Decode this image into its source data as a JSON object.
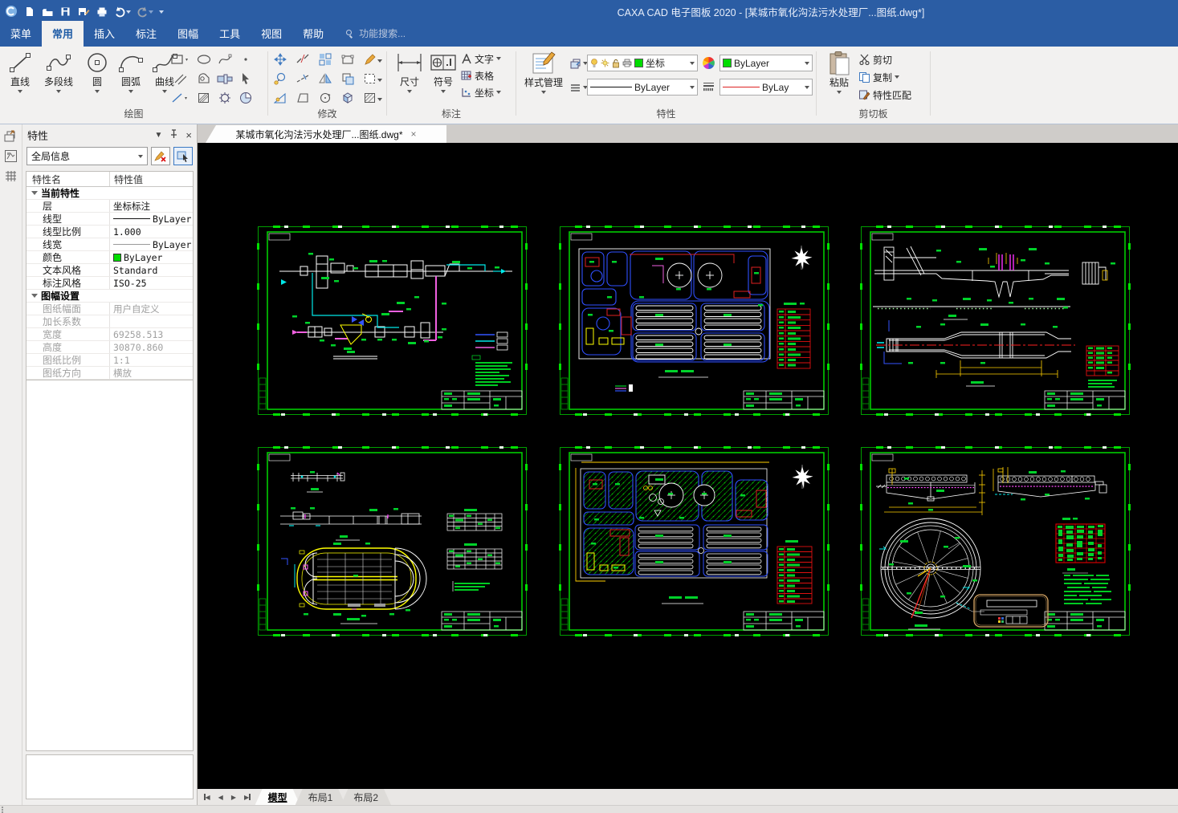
{
  "window": {
    "title": "CAXA CAD 电子图板 2020 - [某城市氧化沟法污水处理厂...图纸.dwg*]"
  },
  "menu_tabs": [
    {
      "label": "菜单",
      "active": false
    },
    {
      "label": "常用",
      "active": true
    },
    {
      "label": "插入",
      "active": false
    },
    {
      "label": "标注",
      "active": false
    },
    {
      "label": "图幅",
      "active": false
    },
    {
      "label": "工具",
      "active": false
    },
    {
      "label": "视图",
      "active": false
    },
    {
      "label": "帮助",
      "active": false
    }
  ],
  "search": {
    "label": "功能搜索..."
  },
  "ribbon": {
    "draw": {
      "label": "绘图",
      "buttons": [
        "直线",
        "多段线",
        "圆",
        "圆弧",
        "曲线"
      ]
    },
    "modify": {
      "label": "修改"
    },
    "annotate": {
      "label": "标注",
      "dimension": "尺寸",
      "symbol": "符号",
      "text": "文字",
      "table": "表格",
      "coordinate": "坐标"
    },
    "properties": {
      "label": "特性",
      "style_manage": "样式管理",
      "layer_value": "坐标",
      "color_value": "ByLayer",
      "linetype_value": "ByLayer",
      "lineweight_value": "ByLay"
    },
    "clipboard": {
      "label": "剪切板",
      "paste": "粘贴",
      "cut": "剪切",
      "copy": "复制",
      "match": "特性匹配"
    }
  },
  "properties_panel": {
    "title": "特性",
    "scope_value": "全局信息",
    "columns": {
      "name": "特性名",
      "value": "特性值"
    },
    "rows": [
      {
        "type": "group",
        "name": "当前特性"
      },
      {
        "type": "item",
        "name": "层",
        "value": "坐标标注"
      },
      {
        "type": "item",
        "name": "线型",
        "value": "ByLayer",
        "swatch": "linetype"
      },
      {
        "type": "item",
        "name": "线型比例",
        "value": "1.000"
      },
      {
        "type": "item",
        "name": "线宽",
        "value": "ByLayer",
        "swatch": "lineweight"
      },
      {
        "type": "item",
        "name": "颜色",
        "value": "ByLayer",
        "swatch": "color"
      },
      {
        "type": "item",
        "name": "文本风格",
        "value": "Standard"
      },
      {
        "type": "item",
        "name": "标注风格",
        "value": "ISO-25"
      },
      {
        "type": "group",
        "name": "图幅设置"
      },
      {
        "type": "item",
        "name": "图纸幅面",
        "value": "用户自定义",
        "disabled": true
      },
      {
        "type": "item",
        "name": "加长系数",
        "value": "",
        "disabled": true
      },
      {
        "type": "item",
        "name": "宽度",
        "value": "69258.513",
        "disabled": true
      },
      {
        "type": "item",
        "name": "高度",
        "value": "30870.860",
        "disabled": true
      },
      {
        "type": "item",
        "name": "图纸比例",
        "value": "1:1",
        "disabled": true
      },
      {
        "type": "item",
        "name": "图纸方向",
        "value": "横放",
        "disabled": true
      }
    ]
  },
  "document_tab": {
    "label": "某城市氧化沟法污水处理厂...图纸.dwg*"
  },
  "sheet_tabs": [
    {
      "label": "模型",
      "active": true
    },
    {
      "label": "布局1",
      "active": false
    },
    {
      "label": "布局2",
      "active": false
    }
  ],
  "colors": {
    "titlebar": "#2b5da4",
    "cad_green": "#00d22a",
    "cad_cyan": "#00e8e8",
    "cad_magenta": "#f060e0",
    "cad_yellow": "#ffff00",
    "cad_red": "#ff2020",
    "cad_blue": "#3355ff",
    "bylayer_swatch": "#00dc00"
  }
}
